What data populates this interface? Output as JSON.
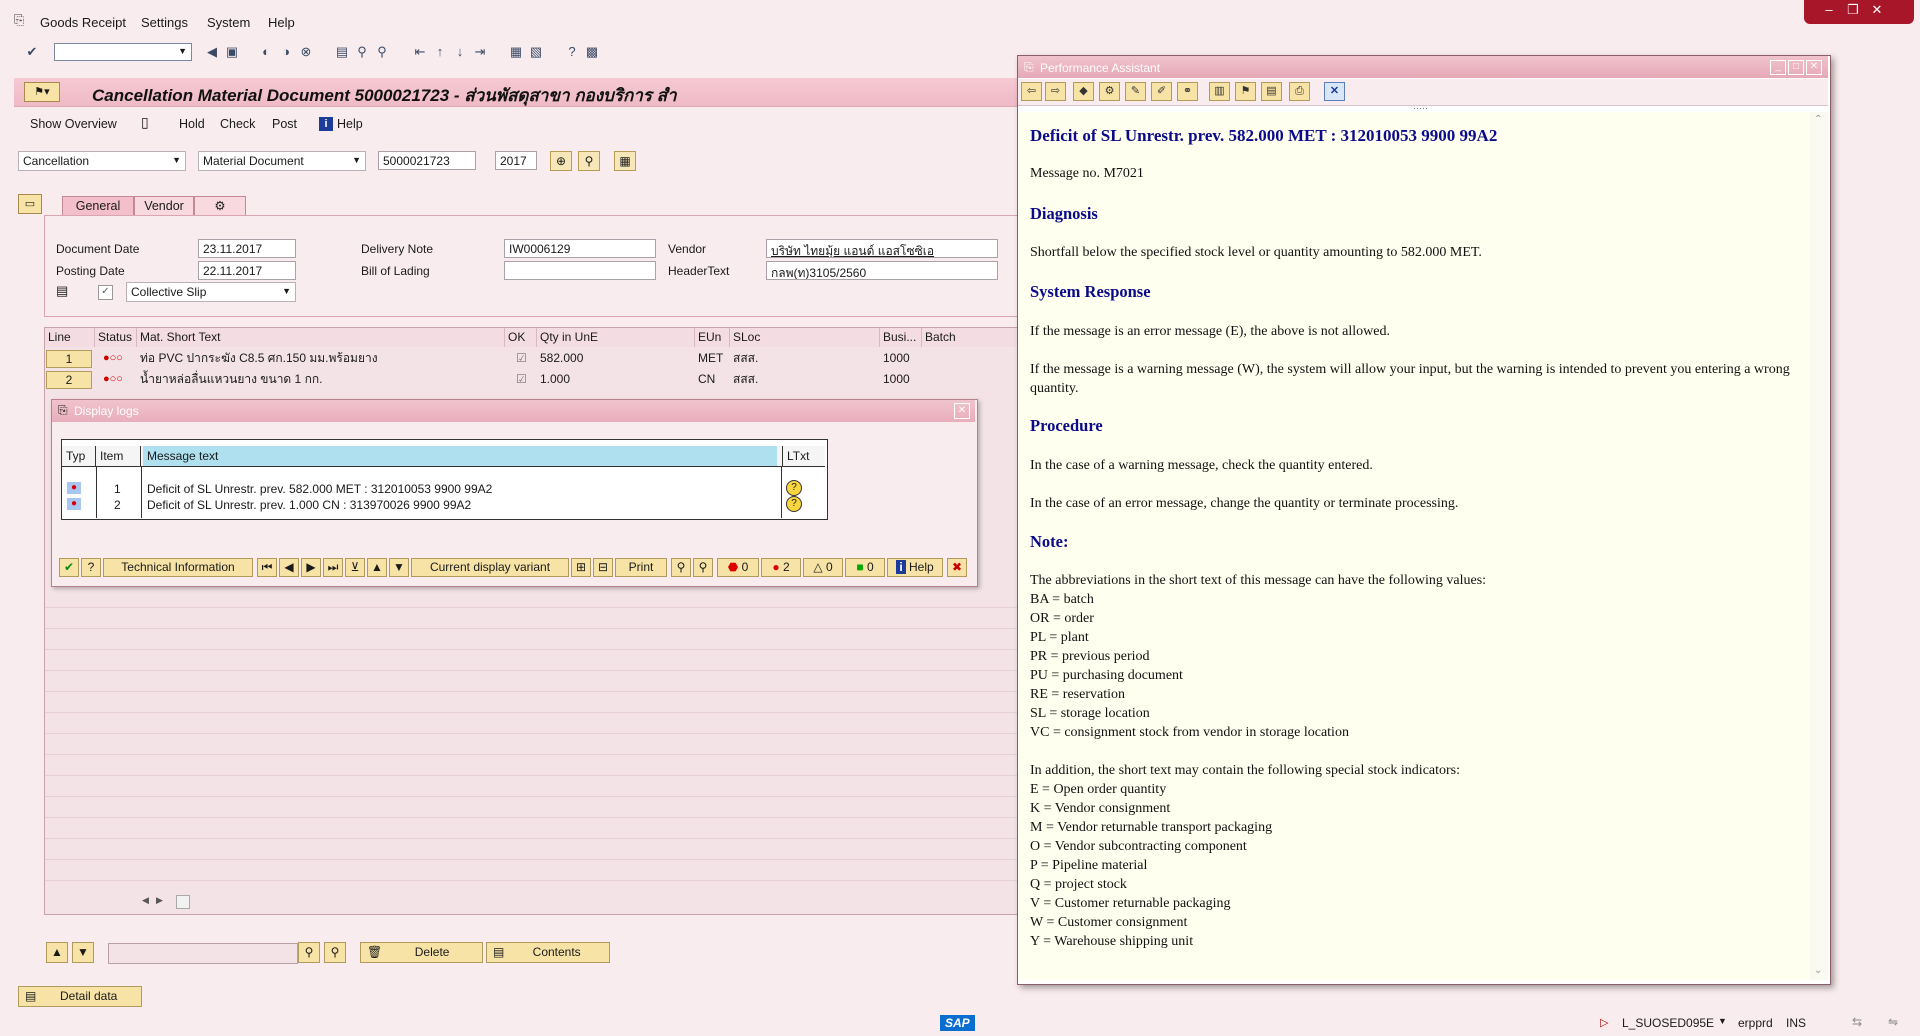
{
  "menu": {
    "goods_receipt": "Goods Receipt",
    "settings": "Settings",
    "system": "System",
    "help": "Help"
  },
  "title": "Cancellation Material Document 5000021723 - ส่วนพัสดุสาขา กองบริการ สำ",
  "app_toolbar": {
    "show_overview": "Show Overview",
    "hold": "Hold",
    "check": "Check",
    "post": "Post",
    "help": "Help"
  },
  "action": {
    "action_value": "Cancellation",
    "ref_type": "Material Document",
    "doc_number": "5000021723",
    "year": "2017"
  },
  "tabs": {
    "general": "General",
    "vendor": "Vendor"
  },
  "header": {
    "document_date_label": "Document Date",
    "document_date": "23.11.2017",
    "posting_date_label": "Posting Date",
    "posting_date": "22.11.2017",
    "delivery_note_label": "Delivery Note",
    "delivery_note": "IW0006129",
    "bill_of_lading_label": "Bill of Lading",
    "bill_of_lading": "",
    "vendor_label": "Vendor",
    "vendor": "บริษัท ไทยมุ้ย แอนด์ แอสโซซิเอ",
    "header_text_label": "HeaderText",
    "header_text": "กลพ(ท)3105/2560",
    "slip_type": "Collective Slip"
  },
  "items": {
    "columns": [
      "Line",
      "Status",
      "Mat. Short Text",
      "OK",
      "Qty in UnE",
      "EUn",
      "SLoc",
      "Busi...",
      "Batch"
    ],
    "rows": [
      {
        "line": "1",
        "text": "ท่อ PVC ปากระฆัง C8.5 ศก.150 มม.พร้อมยาง",
        "qty": "582.000",
        "eun": "MET",
        "sloc": "สสส.",
        "busi": "1000"
      },
      {
        "line": "2",
        "text": "น้ำยาหล่อลื่นแหวนยาง ขนาด 1 กก.",
        "qty": "1.000",
        "eun": "CN",
        "sloc": "สสส.",
        "busi": "1000"
      }
    ]
  },
  "display_logs": {
    "title": "Display logs",
    "columns": [
      "Typ",
      "Item",
      "Message text",
      "LTxt"
    ],
    "rows": [
      {
        "item": "1",
        "text": "Deficit of SL Unrestr. prev. 582.000 MET : 312010053 9900 99A2"
      },
      {
        "item": "2",
        "text": "Deficit of SL Unrestr. prev. 1.000 CN : 313970026 9900 99A2"
      }
    ],
    "buttons": {
      "technical_information": "Technical Information",
      "current_display_variant": "Current display variant",
      "print": "Print",
      "stop_count": "0",
      "error_count": "2",
      "warning_count": "0",
      "success_count": "0",
      "help": "Help"
    }
  },
  "bottom": {
    "delete": "Delete",
    "contents": "Contents",
    "detail_data": "Detail data"
  },
  "perf_assistant": {
    "title": "Performance Assistant",
    "heading": "Deficit of SL Unrestr. prev. 582.000 MET : 312010053 9900 99A2",
    "message_no": "Message no. M7021",
    "diagnosis_h": "Diagnosis",
    "diagnosis": "Shortfall below the specified stock level or quantity amounting to 582.000 MET.",
    "system_response_h": "System Response",
    "sr1": "If the message is an error message (E), the above is not allowed.",
    "sr2": "If the message is a warning message (W), the system will allow your input, but the warning is intended to prevent you entering a wrong quantity.",
    "procedure_h": "Procedure",
    "proc1": "In the case of a warning message, check the quantity entered.",
    "proc2": "In the case of an error message, change the quantity or terminate processing.",
    "note_h": "Note:",
    "note_intro": "The abbreviations in the short text of this message can have the following values:",
    "abbrev": [
      "BA = batch",
      "OR = order",
      "PL = plant",
      "PR = previous period",
      "PU = purchasing document",
      "RE = reservation",
      "SL = storage location",
      "VC = consignment stock from vendor in storage location"
    ],
    "special_intro": "In addition, the short text may contain the following special stock indicators:",
    "special": [
      "E = Open order quantity",
      "K = Vendor consignment",
      "M = Vendor returnable transport packaging",
      "O = Vendor subcontracting component",
      "P = Pipeline material",
      "Q = project stock",
      "V = Customer returnable packaging",
      "W = Customer consignment",
      "Y = Warehouse shipping unit"
    ]
  },
  "status": {
    "sap_logo": "SAP",
    "session": "L_SUOSED095E",
    "system": "erpprd",
    "mode": "INS"
  },
  "colors": {
    "accent": "#0a0a8a",
    "title_bar": "#eebac6",
    "button": "#f7e3a6"
  }
}
